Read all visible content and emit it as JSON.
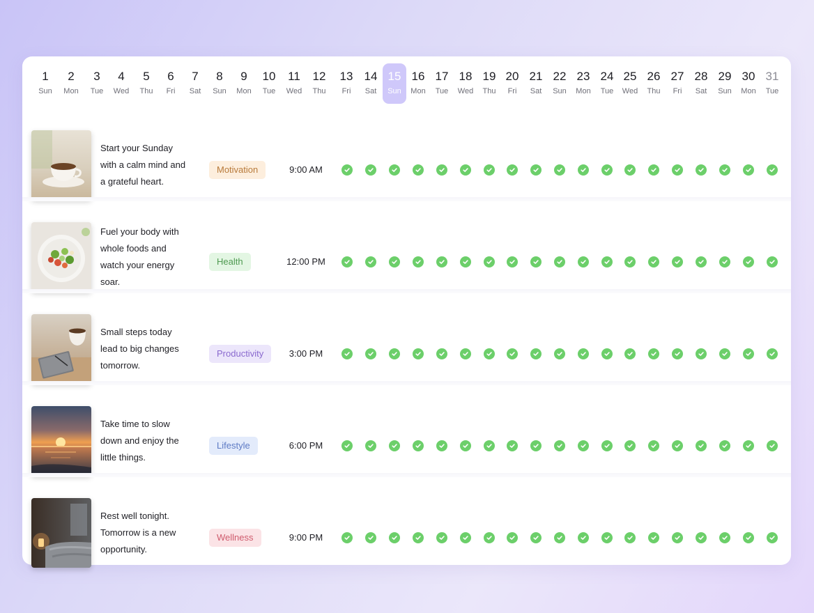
{
  "calendar": {
    "days": [
      {
        "num": "1",
        "wd": "Sun"
      },
      {
        "num": "2",
        "wd": "Mon"
      },
      {
        "num": "3",
        "wd": "Tue"
      },
      {
        "num": "4",
        "wd": "Wed"
      },
      {
        "num": "5",
        "wd": "Thu"
      },
      {
        "num": "6",
        "wd": "Fri"
      },
      {
        "num": "7",
        "wd": "Sat"
      },
      {
        "num": "8",
        "wd": "Sun"
      },
      {
        "num": "9",
        "wd": "Mon"
      },
      {
        "num": "10",
        "wd": "Tue"
      },
      {
        "num": "11",
        "wd": "Wed"
      },
      {
        "num": "12",
        "wd": "Thu"
      },
      {
        "num": "13",
        "wd": "Fri"
      },
      {
        "num": "14",
        "wd": "Sat"
      },
      {
        "num": "15",
        "wd": "Sun"
      },
      {
        "num": "16",
        "wd": "Mon"
      },
      {
        "num": "17",
        "wd": "Tue"
      },
      {
        "num": "18",
        "wd": "Wed"
      },
      {
        "num": "19",
        "wd": "Thu"
      },
      {
        "num": "20",
        "wd": "Fri"
      },
      {
        "num": "21",
        "wd": "Sat"
      },
      {
        "num": "22",
        "wd": "Sun"
      },
      {
        "num": "23",
        "wd": "Mon"
      },
      {
        "num": "24",
        "wd": "Tue"
      },
      {
        "num": "25",
        "wd": "Wed"
      },
      {
        "num": "26",
        "wd": "Thu"
      },
      {
        "num": "27",
        "wd": "Fri"
      },
      {
        "num": "28",
        "wd": "Sat"
      },
      {
        "num": "29",
        "wd": "Sun"
      },
      {
        "num": "30",
        "wd": "Mon"
      },
      {
        "num": "31",
        "wd": "Tue"
      }
    ],
    "selected_day": "15",
    "accent_color": "#cfc8fa",
    "check_color": "#6ccf6a"
  },
  "rows": [
    {
      "image_icon": "coffee-cup-image",
      "lines": [
        "Start your Sunday",
        "with a calm mind and",
        "a grateful heart."
      ],
      "tag": "Motivation",
      "tag_bg": "#fdeedd",
      "tag_fg": "#b87a3a",
      "time": "9:00 AM",
      "checks": 19
    },
    {
      "image_icon": "salad-bowl-image",
      "lines": [
        "Fuel your body with",
        "whole foods and",
        "watch your energy",
        "soar."
      ],
      "tag": "Health",
      "tag_bg": "#e3f6e3",
      "tag_fg": "#4f9a51",
      "time": "12:00 PM",
      "checks": 19
    },
    {
      "image_icon": "notebook-coffee-image",
      "lines": [
        "Small steps today",
        "lead to big changes",
        "tomorrow."
      ],
      "tag": "Productivity",
      "tag_bg": "#ece6fb",
      "tag_fg": "#8a69cf",
      "time": "3:00 PM",
      "checks": 19
    },
    {
      "image_icon": "sunset-sea-image",
      "lines": [
        "Take time to slow",
        "down and enjoy the",
        "little things."
      ],
      "tag": "Lifestyle",
      "tag_bg": "#e3ebfb",
      "tag_fg": "#5d7ac4",
      "time": "6:00 PM",
      "checks": 19
    },
    {
      "image_icon": "cozy-bedroom-image",
      "lines": [
        "Rest well tonight.",
        "Tomorrow is a new",
        "opportunity."
      ],
      "tag": "Wellness",
      "tag_bg": "#fbe3e6",
      "tag_fg": "#cf5b6d",
      "time": "9:00 PM",
      "checks": 19
    }
  ]
}
